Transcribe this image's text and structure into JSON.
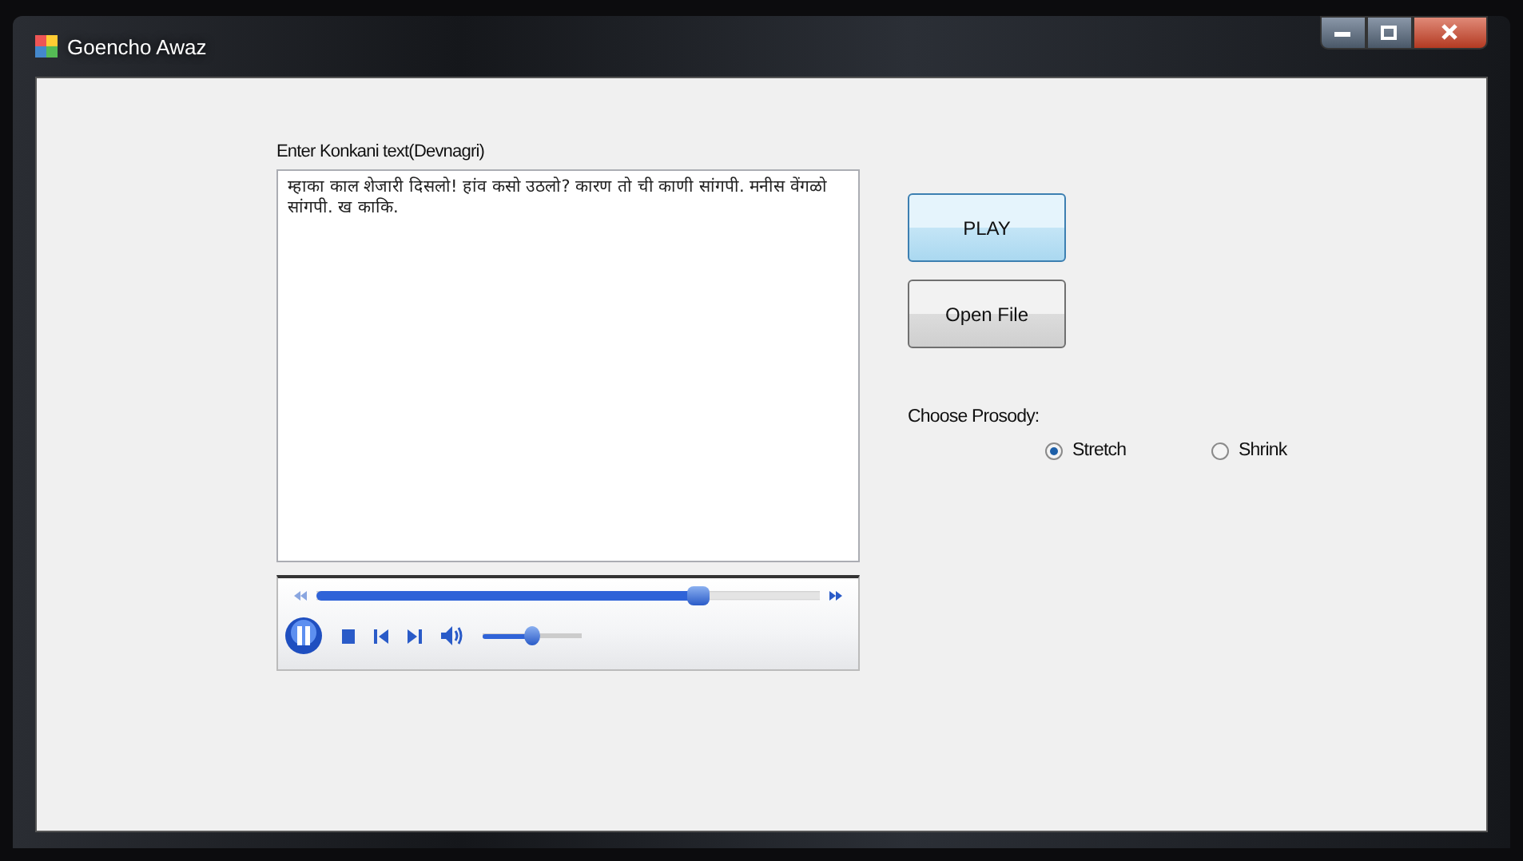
{
  "window": {
    "title": "Goencho Awaz"
  },
  "editor": {
    "label": "Enter Konkani text(Devnagri)",
    "value": "म्हाका काल शेजारी दिसलो! हांव कसो उठलो? कारण तो ची काणी सांगपी. मनीस वेंगळो सांगपी. ख काकि."
  },
  "player": {
    "seek": {
      "level": 0.77
    },
    "volume": {
      "level": 0.5
    }
  },
  "buttons": [
    {
      "label": "PLAY",
      "kind": "primary"
    },
    {
      "label": "Open File",
      "kind": "normal"
    }
  ],
  "prosody": {
    "label": "Choose Prosody:",
    "options": [
      {
        "label": "Stretch",
        "selected": true
      },
      {
        "label": "Shrink",
        "selected": false
      }
    ]
  }
}
